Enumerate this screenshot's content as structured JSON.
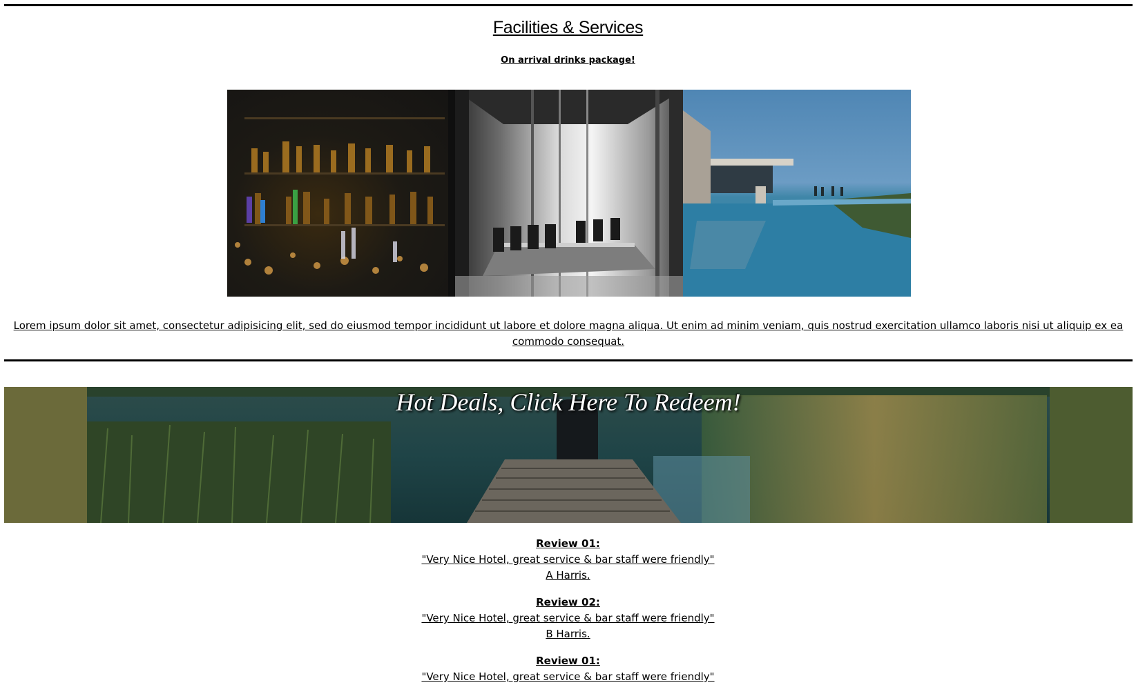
{
  "section": {
    "title": "Facilities & Services",
    "subtitle": "On arrival drinks package!",
    "description": "Lorem ipsum dolor sit amet, consectetur adipisicing elit, sed do eiusmod tempor incididunt ut labore et dolore magna aliqua. Ut enim ad minim veniam, quis nostrud exercitation ullamco laboris nisi ut aliquip ex ea commodo consequat."
  },
  "gallery": {
    "photos": [
      {
        "icon": "bar-shelves-photo"
      },
      {
        "icon": "meeting-room-photo"
      },
      {
        "icon": "infinity-pool-photo"
      }
    ]
  },
  "banner": {
    "title": "Hot Deals, Click Here To Redeem!"
  },
  "reviews": [
    {
      "title": "Review 01:",
      "quote": "\"Very Nice Hotel, great service & bar staff were friendly\"",
      "author": "A Harris."
    },
    {
      "title": "Review 02:",
      "quote": "\"Very Nice Hotel, great service & bar staff were friendly\"",
      "author": "B Harris."
    },
    {
      "title": "Review 01:",
      "quote": "\"Very Nice Hotel, great service & bar staff were friendly\"",
      "author": ""
    }
  ],
  "colors": {
    "text": "#000000",
    "background": "#ffffff",
    "banner_text": "#ffffff"
  }
}
